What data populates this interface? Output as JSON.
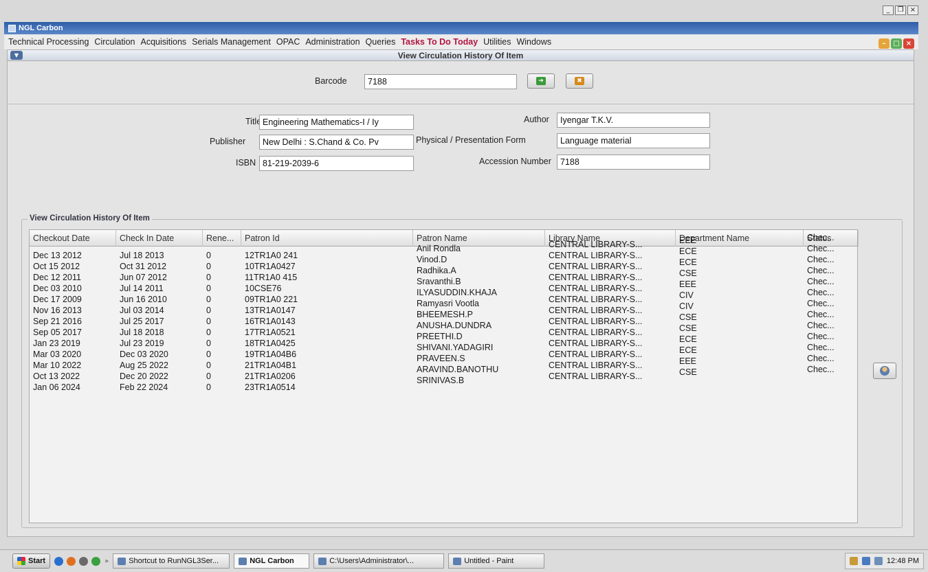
{
  "outer_controls": {
    "minimize": "_",
    "restore": "❐",
    "close": "×"
  },
  "app_title": "NGL Carbon",
  "menu": [
    {
      "label": "Technical Processing"
    },
    {
      "label": "Circulation"
    },
    {
      "label": "Acquisitions"
    },
    {
      "label": "Serials Management"
    },
    {
      "label": "OPAC"
    },
    {
      "label": "Administration"
    },
    {
      "label": "Queries"
    },
    {
      "label": "Tasks To Do Today",
      "highlight": true
    },
    {
      "label": "Utilities"
    },
    {
      "label": "Windows"
    }
  ],
  "colors": {
    "menu_highlight": "#b3153f",
    "titlebar": "#2f5ea9"
  },
  "window_title": "View Circulation History Of Item",
  "barcode": {
    "label": "Barcode",
    "value": "7188"
  },
  "details": {
    "title_label": "Title",
    "title_value": "Engineering Mathematics-I / Iy",
    "publisher_label": "Publisher",
    "publisher_value": "New Delhi : S.Chand & Co. Pv",
    "isbn_label": "ISBN",
    "isbn_value": "81-219-2039-6",
    "author_label": "Author",
    "author_value": "Iyengar T.K.V.",
    "form_label": "Physical / Presentation Form",
    "form_value": "Language material",
    "accession_label": "Accession Number",
    "accession_value": "7188"
  },
  "history_section_title": "View Circulation History Of Item",
  "table": {
    "headers": [
      "Checkout Date",
      "Check In Date",
      "Rene...",
      "Patron Id",
      "Patron Name",
      "Library Name",
      "Department Name",
      "Status"
    ],
    "rows": [
      [
        "Dec 13 2012",
        "Jul 18 2013",
        "0",
        "12TR1A0 241",
        "Anil Rondla",
        "CENTRAL LIBRARY-S...",
        "EEE",
        "Chec..."
      ],
      [
        "Oct 15 2012",
        "Oct 31 2012",
        "0",
        "10TR1A0427",
        "Vinod.D",
        "CENTRAL LIBRARY-S...",
        "ECE",
        "Chec..."
      ],
      [
        "Dec 12 2011",
        "Jun 07 2012",
        "0",
        "11TR1A0 415",
        "Radhika.A",
        "CENTRAL LIBRARY-S...",
        "ECE",
        "Chec..."
      ],
      [
        "Dec 03 2010",
        "Jul 14 2011",
        "0",
        "10CSE76",
        "Sravanthi.B",
        "CENTRAL LIBRARY-S...",
        "CSE",
        "Chec..."
      ],
      [
        "Dec 17 2009",
        "Jun 16 2010",
        "0",
        "09TR1A0 221",
        "ILYASUDDIN.KHAJA",
        "CENTRAL LIBRARY-S...",
        "EEE",
        "Chec..."
      ],
      [
        "Nov 16 2013",
        "Jul 03 2014",
        "0",
        "13TR1A0147",
        "Ramyasri Vootla",
        "CENTRAL LIBRARY-S...",
        "CIV",
        "Chec..."
      ],
      [
        "Sep 21 2016",
        "Jul 25 2017",
        "0",
        "16TR1A0143",
        "BHEEMESH.P",
        "CENTRAL LIBRARY-S...",
        "CIV",
        "Chec..."
      ],
      [
        "Sep 05 2017",
        "Jul 18 2018",
        "0",
        "17TR1A0521",
        "ANUSHA.DUNDRA",
        "CENTRAL LIBRARY-S...",
        "CSE",
        "Chec..."
      ],
      [
        "Jan 23 2019",
        "Jul 23 2019",
        "0",
        "18TR1A0425",
        "PREETHI.D",
        "CENTRAL LIBRARY-S...",
        "CSE",
        "Chec..."
      ],
      [
        "Mar 03 2020",
        "Dec 03 2020",
        "0",
        "19TR1A04B6",
        "SHIVANI.YADAGIRI",
        "CENTRAL LIBRARY-S...",
        "ECE",
        "Chec..."
      ],
      [
        "Mar 10 2022",
        "Aug 25 2022",
        "0",
        "21TR1A04B1",
        "PRAVEEN.S",
        "CENTRAL LIBRARY-S...",
        "ECE",
        "Chec..."
      ],
      [
        "Oct 13 2022",
        "Dec 20 2022",
        "0",
        "21TR1A0206",
        "ARAVIND.BANOTHU",
        "CENTRAL LIBRARY-S...",
        "EEE",
        "Chec..."
      ],
      [
        "Jan 06 2024",
        "Feb 22 2024",
        "0",
        "23TR1A0514",
        "SRINIVAS.B",
        "CENTRAL LIBRARY-S...",
        "CSE",
        "Chec..."
      ]
    ]
  },
  "taskbar": {
    "start": "Start",
    "overflow": "»",
    "items": [
      "Shortcut to RunNGL3Ser...",
      "NGL Carbon",
      "C:\\Users\\Administrator\\...",
      "Untitled - Paint"
    ],
    "clock": "12:48 PM"
  }
}
